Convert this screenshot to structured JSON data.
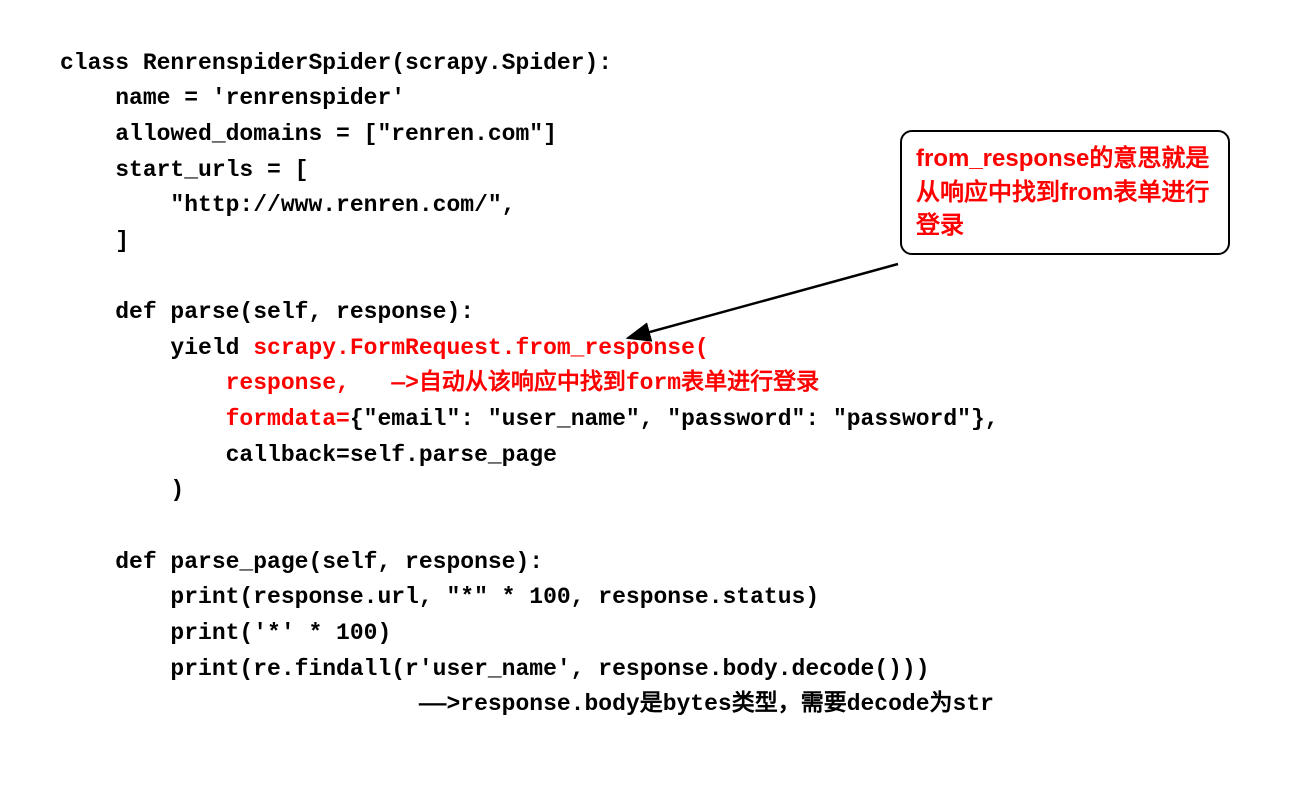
{
  "code": {
    "l1": "class RenrenspiderSpider(scrapy.Spider):",
    "l2": "    name = 'renrenspider'",
    "l3": "    allowed_domains = [\"renren.com\"]",
    "l4": "    start_urls = [",
    "l5": "        \"http://www.renren.com/\",",
    "l6": "    ]",
    "l7": "",
    "l8": "    def parse(self, response):",
    "l9a": "        yield ",
    "l9b": "scrapy.FormRequest.from_response(",
    "l10a": "            response,   ",
    "l10b": "—>自动从该响应中找到form表单进行登录",
    "l11a": "            formdata=",
    "l11b": "{\"email\": \"user_name\", \"password\": \"password\"},",
    "l12": "            callback=self.parse_page",
    "l13": "        )",
    "l14": "",
    "l15": "    def parse_page(self, response):",
    "l16": "        print(response.url, \"*\" * 100, response.status)",
    "l17": "        print('*' * 100)",
    "l18": "        print(re.findall(r'user_name', response.body.decode()))",
    "l19": "                          ——>response.body是bytes类型，需要decode为str"
  },
  "callout": {
    "text": "from_response的意思就是从响应中找到from表单进行登录"
  }
}
